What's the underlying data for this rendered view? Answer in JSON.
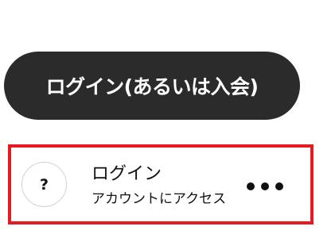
{
  "login_button": {
    "label": "ログイン(あるいは入会)"
  },
  "account_card": {
    "avatar_glyph": "?",
    "title": "ログイン",
    "subtitle": "アカウントにアクセス",
    "more_icon": "ellipsis-horizontal-icon"
  },
  "colors": {
    "pill_background": "#2b2b2b",
    "highlight_border": "#e41b23"
  }
}
